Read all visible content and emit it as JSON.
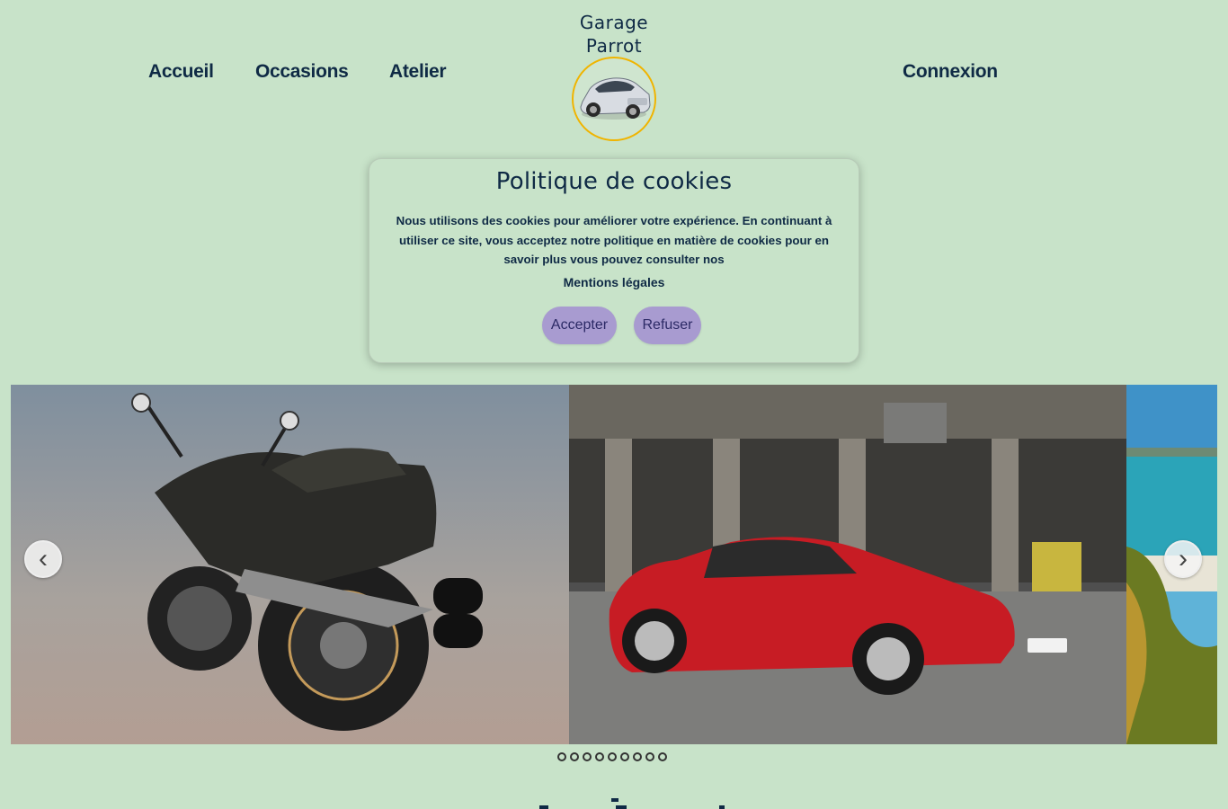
{
  "nav": {
    "home": "Accueil",
    "used": "Occasions",
    "workshop": "Atelier",
    "login": "Connexion"
  },
  "brand": {
    "line1": "Garage",
    "line2": "Parrot"
  },
  "cookie_banner": {
    "title": "Politique de cookies",
    "text": "Nous utilisons des cookies pour améliorer votre expérience. En continuant à utiliser ce site, vous acceptez notre politique en matière de cookies pour en savoir plus vous pouvez consulter nos",
    "legal_link": "Mentions légales",
    "accept": "Accepter",
    "refuse": "Refuser"
  },
  "carousel": {
    "prev_icon": "‹",
    "next_icon": "›",
    "slides": [
      "motorcycle-image",
      "red-car-image",
      "beach-image"
    ],
    "dot_count": 9,
    "active_dot": 0
  },
  "colors": {
    "background": "#c8e3c9",
    "text": "#0f2a45",
    "button": "#a89bd0",
    "logo_ring": "#f0b400"
  }
}
